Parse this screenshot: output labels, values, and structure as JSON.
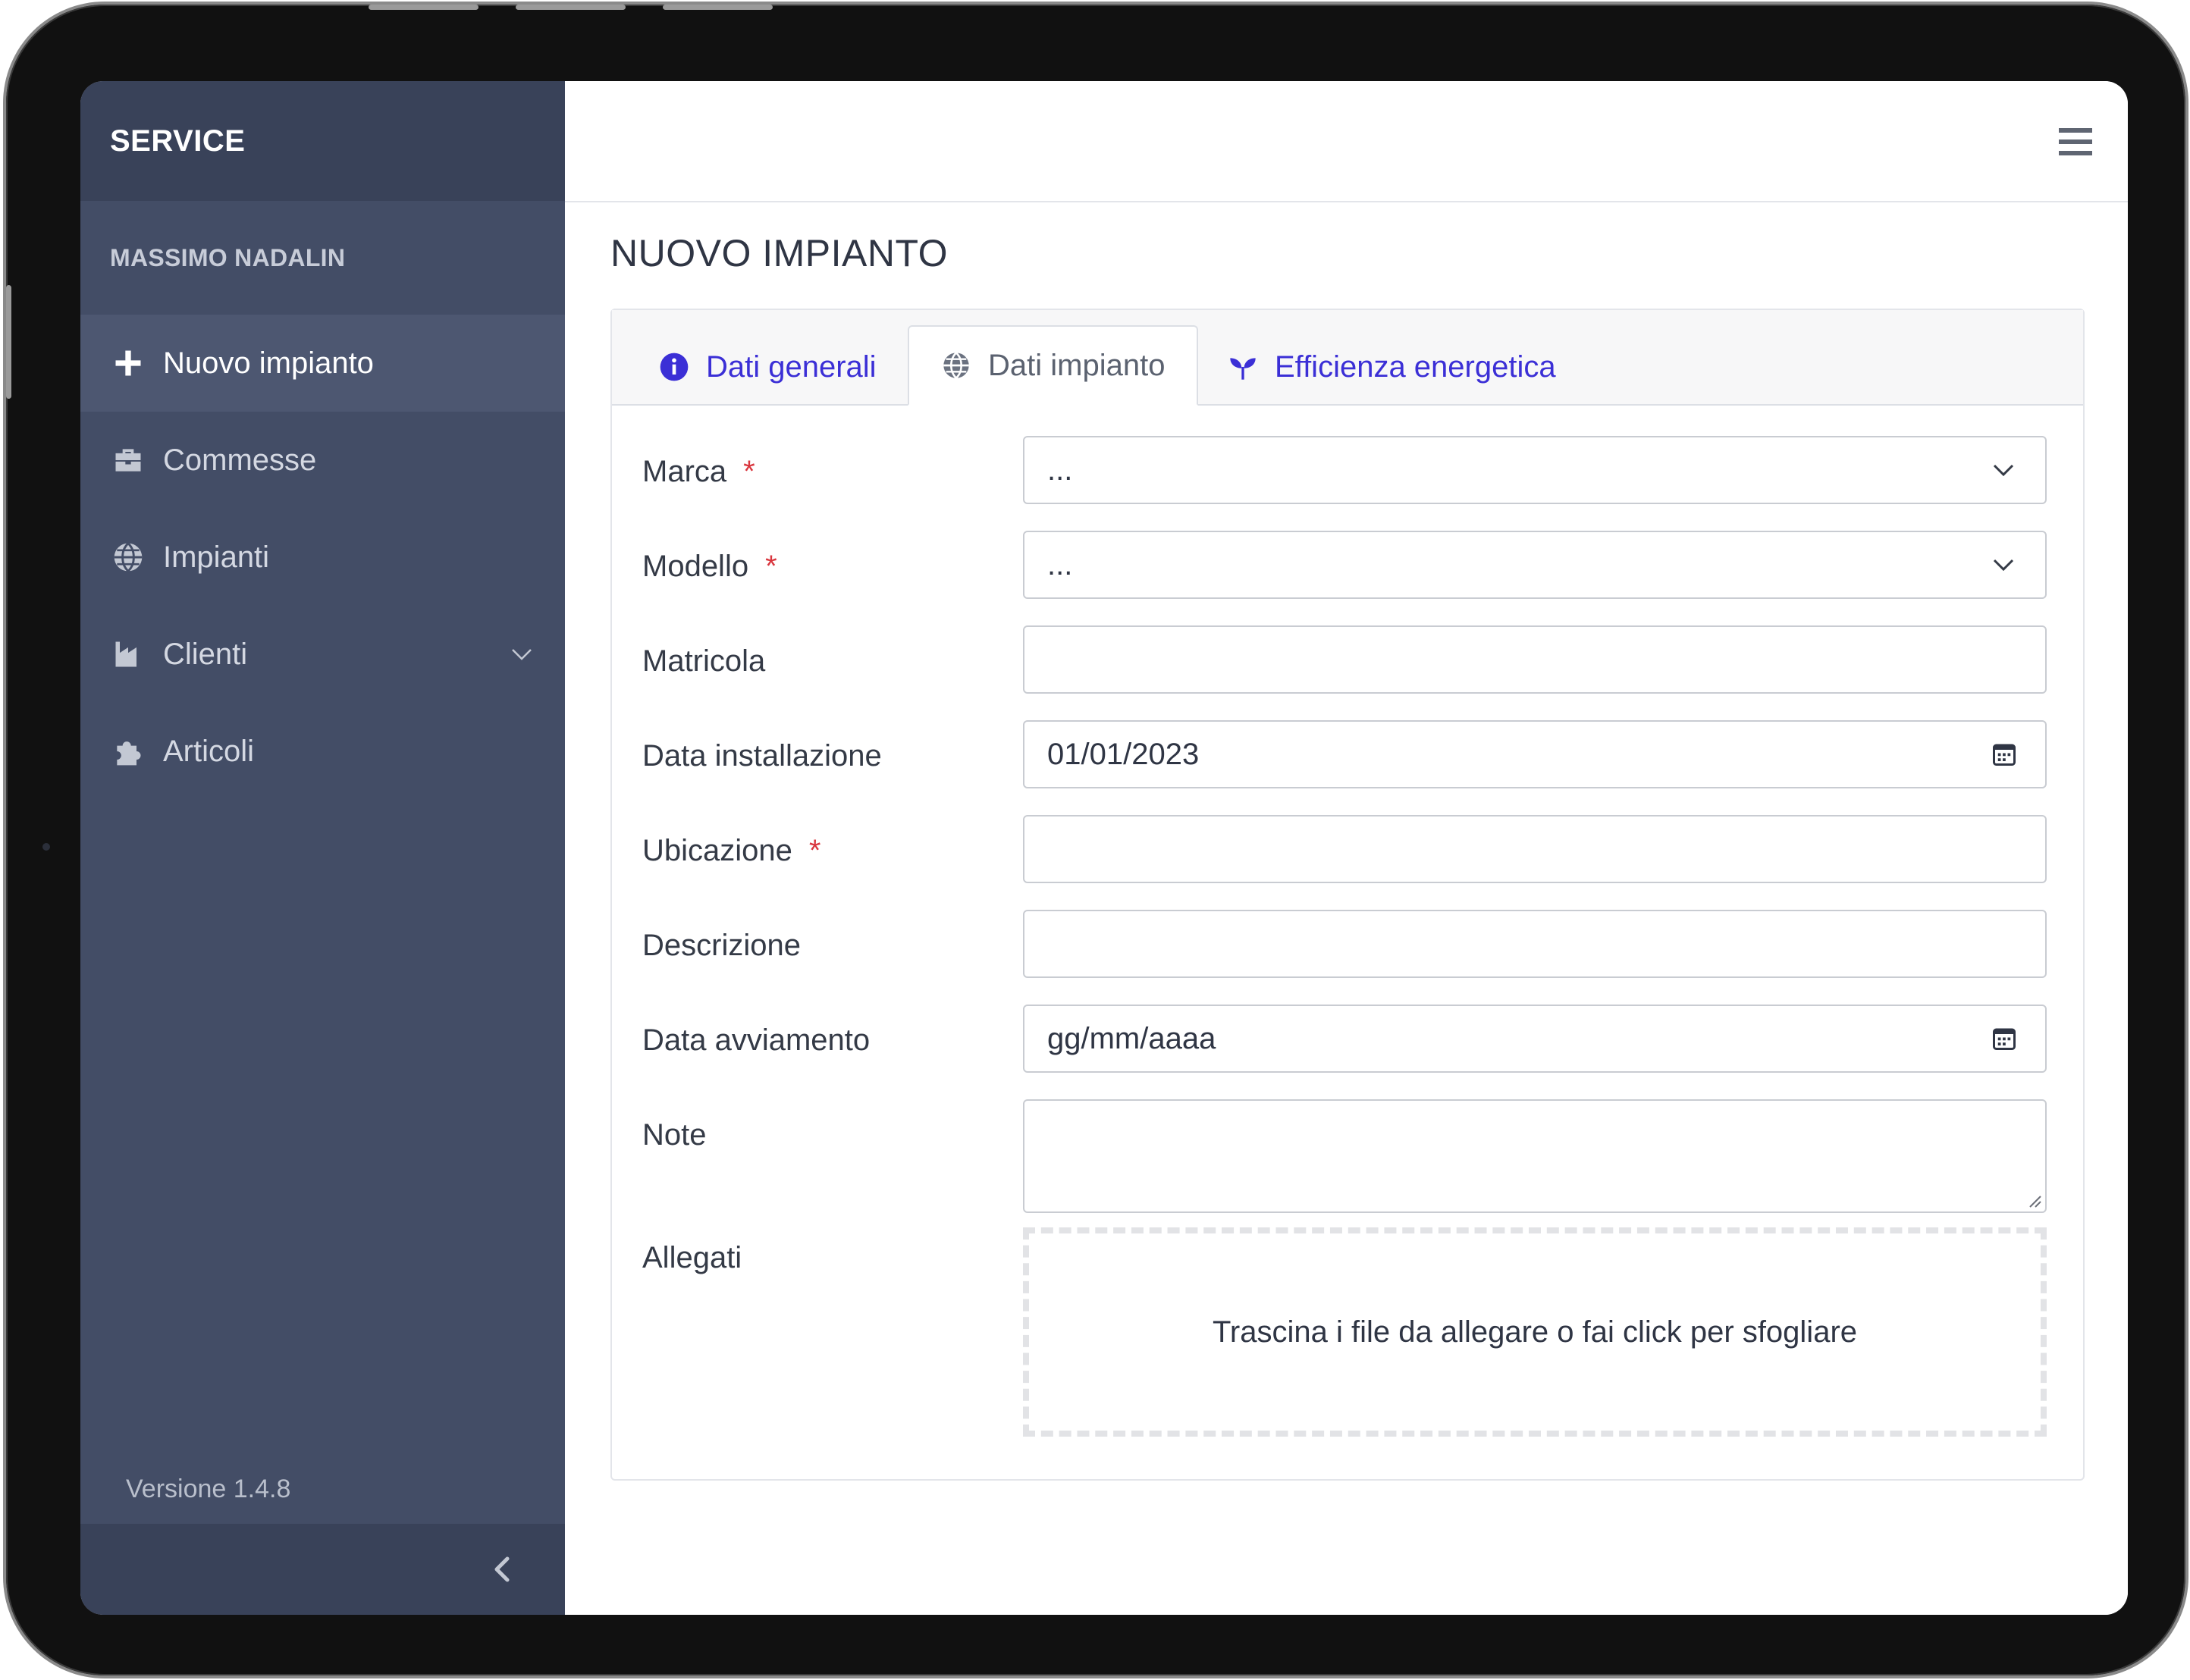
{
  "app": {
    "brand": "SERVICE",
    "user_name": "MASSIMO NADALIN",
    "version": "Versione 1.4.8"
  },
  "sidebar": {
    "items": [
      {
        "label": "Nuovo impianto",
        "icon": "plus-icon",
        "active": true
      },
      {
        "label": "Commesse",
        "icon": "toolbox-icon",
        "active": false
      },
      {
        "label": "Impianti",
        "icon": "globe-icon",
        "active": false
      },
      {
        "label": "Clienti",
        "icon": "industry-icon",
        "active": false,
        "expandable": true
      },
      {
        "label": "Articoli",
        "icon": "puzzle-icon",
        "active": false
      }
    ]
  },
  "page": {
    "title": "NUOVO IMPIANTO",
    "tabs": [
      {
        "label": "Dati generali",
        "icon": "info-circle-icon",
        "active": false
      },
      {
        "label": "Dati impianto",
        "icon": "globe-icon",
        "active": true
      },
      {
        "label": "Efficienza energetica",
        "icon": "seedling-icon",
        "active": false
      }
    ]
  },
  "form": {
    "marca": {
      "label": "Marca",
      "required": "*",
      "value": "..."
    },
    "modello": {
      "label": "Modello",
      "required": "*",
      "value": "..."
    },
    "matricola": {
      "label": "Matricola",
      "value": ""
    },
    "data_installazione": {
      "label": "Data installazione",
      "value": "01/01/2023"
    },
    "ubicazione": {
      "label": "Ubicazione",
      "required": "*",
      "value": ""
    },
    "descrizione": {
      "label": "Descrizione",
      "value": ""
    },
    "data_avviamento": {
      "label": "Data avviamento",
      "placeholder": "gg/mm/aaaa"
    },
    "note": {
      "label": "Note",
      "value": ""
    },
    "allegati": {
      "label": "Allegati",
      "dropzone_text": "Trascina i file da allegare o fai click per sfogliare"
    }
  },
  "colors": {
    "sidebar_bg": "#434d66",
    "sidebar_header_bg": "#394259",
    "tab_link": "#3b2fd6",
    "required": "#d9363e"
  }
}
